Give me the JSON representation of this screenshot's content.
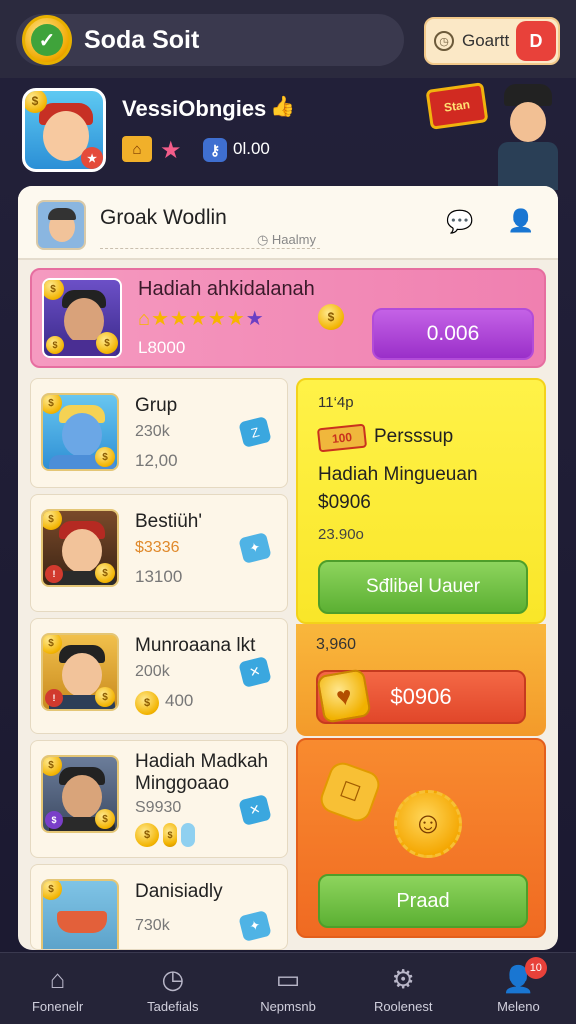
{
  "header": {
    "app_title": "Soda Soit",
    "search_label": "Goartt",
    "badge_label": "D"
  },
  "profile": {
    "name": "VessiObngies",
    "balance": "0l.00"
  },
  "hero": {
    "sign_text": "Stan"
  },
  "card": {
    "title": "Groak Wodlin",
    "subtitle": "Haalmy",
    "featured": {
      "title": "Hadiah ahkidalanah",
      "amount": "L8000",
      "button_label": "0.006"
    },
    "list": [
      {
        "name": "Grup",
        "v1": "230k",
        "v2": "12,00",
        "tag": "Z"
      },
      {
        "name": "Bestiüh'",
        "v1": "$3336",
        "v2": "13100",
        "tag": "✦"
      },
      {
        "name": "Munroaana lkt",
        "v1": "200k",
        "v2": "400",
        "tag": "✕"
      },
      {
        "name": "Hadiah Madkah Minggoaao",
        "v1": "S9930",
        "v2": "",
        "tag": "✕"
      },
      {
        "name": "Danisiadly",
        "v1": "730k",
        "v2": "",
        "tag": "✦"
      }
    ],
    "promo": {
      "time": "11‘4p",
      "icon_text": "100",
      "headline": "Persssup",
      "title": "Hadiah Mingueuan",
      "price": "$0906",
      "sub_amount": "23.90o",
      "button_label": "Sđlibel Uauer"
    },
    "promo2": {
      "amount": "3,960",
      "button_label": "$0906"
    },
    "promo3": {
      "button_label": "Praad"
    }
  },
  "nav": {
    "items": [
      {
        "label": "Fonenelr",
        "icon": "home-icon"
      },
      {
        "label": "Tadefials",
        "icon": "clock-icon"
      },
      {
        "label": "Nepmsnb",
        "icon": "card-icon"
      },
      {
        "label": "Roolenest",
        "icon": "settings-icon"
      },
      {
        "label": "Meleno",
        "icon": "user-icon",
        "badge": "10"
      }
    ]
  },
  "colors": {
    "background": "#1c1a2e",
    "featured": "#f080b0",
    "purple_button": "#9a2fc9",
    "yellow_panel": "#f9e629",
    "green_button": "#5cb033",
    "orange_panel": "#f06a22"
  }
}
